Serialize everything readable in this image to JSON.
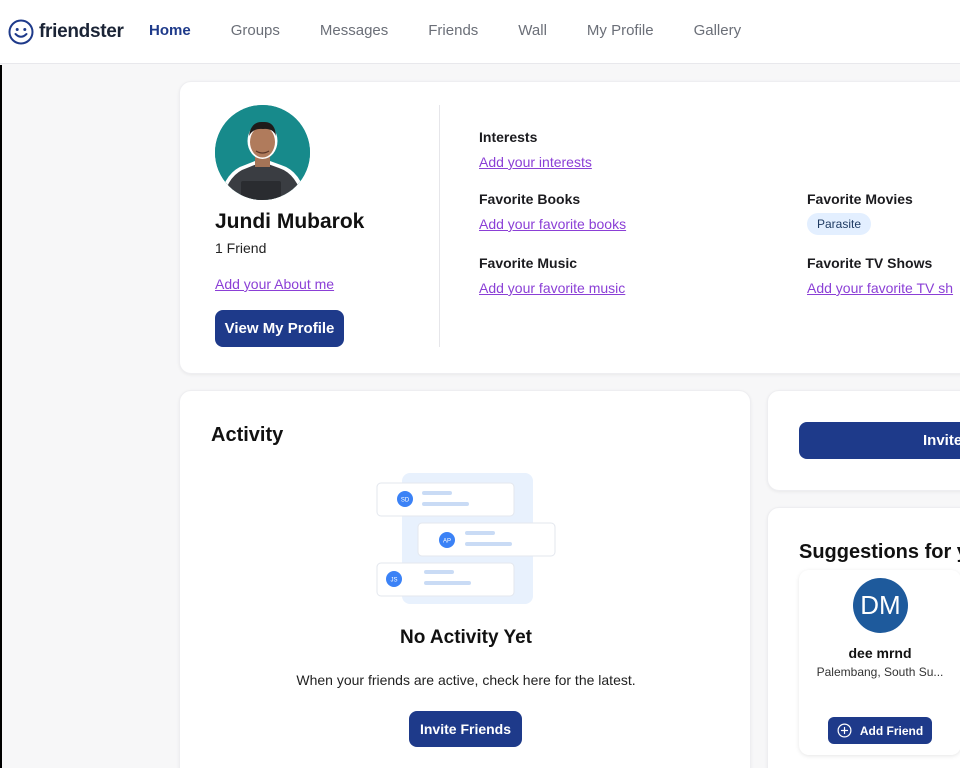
{
  "brand": {
    "name": "friendster"
  },
  "nav": {
    "items": [
      {
        "label": "Home",
        "active": true
      },
      {
        "label": "Groups",
        "active": false
      },
      {
        "label": "Messages",
        "active": false
      },
      {
        "label": "Friends",
        "active": false
      },
      {
        "label": "Wall",
        "active": false
      },
      {
        "label": "My Profile",
        "active": false
      },
      {
        "label": "Gallery",
        "active": false
      }
    ]
  },
  "profile": {
    "name": "Jundi Mubarok",
    "friends_count": "1 Friend",
    "about_link": "Add your About me",
    "view_profile_label": "View My Profile",
    "interests": {
      "label": "Interests",
      "link": "Add your interests"
    },
    "books": {
      "label": "Favorite Books",
      "link": "Add your favorite books"
    },
    "movies": {
      "label": "Favorite Movies",
      "tag": "Parasite"
    },
    "music": {
      "label": "Favorite Music",
      "link": "Add your favorite music"
    },
    "tv": {
      "label": "Favorite TV Shows",
      "link": "Add your favorite TV sh"
    }
  },
  "activity": {
    "title": "Activity",
    "empty_title": "No Activity Yet",
    "empty_desc": "When your friends are active, check here for the latest.",
    "invite_label": "Invite Friends",
    "illustration_initials": [
      "SD",
      "AP",
      "JS"
    ]
  },
  "invite_card": {
    "label": "Invite"
  },
  "suggestions": {
    "title": "Suggestions for y",
    "items": [
      {
        "initials": "DM",
        "name": "dee mrnd",
        "location": "Palembang, South Su...",
        "add_label": "Add Friend"
      }
    ]
  },
  "colors": {
    "primary": "#1e3a8a",
    "link": "#8b3fd6",
    "tag_bg": "#e3efff",
    "avatar_bg": "#1e5a9c"
  },
  "icons": {
    "logo": "smiley-icon",
    "add": "plus-circle-icon"
  }
}
